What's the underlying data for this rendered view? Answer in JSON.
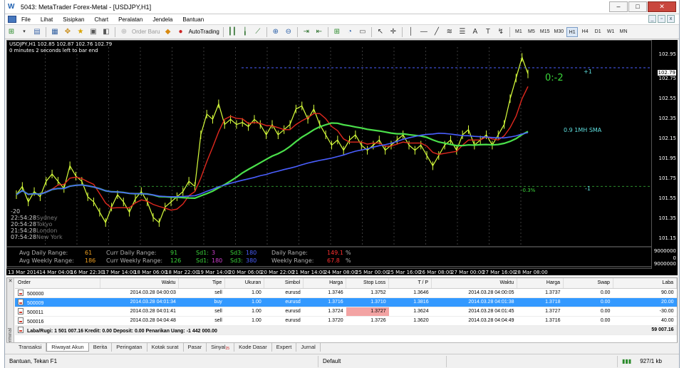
{
  "window": {
    "title": "5043: MetaTrader Forex-Metal - [USDJPY,H1]",
    "buttons": [
      "–",
      "□",
      "✕"
    ]
  },
  "menu": [
    "File",
    "Lihat",
    "Sisipkan",
    "Chart",
    "Peralatan",
    "Jendela",
    "Bantuan"
  ],
  "toolbar": {
    "order_label": "Order Baru",
    "autotrading_label": "AutoTrading",
    "timeframes": [
      "M1",
      "M5",
      "M15",
      "M30",
      "H1",
      "H4",
      "D1",
      "W1",
      "MN"
    ],
    "active_timeframe": "H1"
  },
  "chart": {
    "symbol_line": "USDJPY,H1  102.85 102.87 102.76 102.79",
    "countdown": "0 minutes 2 seconds left to bar end",
    "y_ticks": [
      "102.95",
      "102.75",
      "102.55",
      "102.35",
      "102.15",
      "101.95",
      "101.75",
      "101.55",
      "101.35",
      "101.15"
    ],
    "current_price": "102.79",
    "sub_ticks": [
      "9000000",
      "0",
      "9000000"
    ],
    "x_ticks": [
      "13 Mar 2014",
      "14 Mar 04:00",
      "16 Mar 22:30",
      "17 Mar 14:00",
      "18 Mar 06:00",
      "18 Mar 22:00",
      "19 Mar 14:00",
      "20 Mar 06:00",
      "20 Mar 22:00",
      "21 Mar 14:00",
      "24 Mar 08:00",
      "25 Mar 00:00",
      "25 Mar 16:00",
      "26 Mar 08:00",
      "27 Mar 00:00",
      "27 Mar 16:00",
      "28 Mar 08:00"
    ],
    "annotations": {
      "ratio": "0:-2",
      "sma": "0.9 1MH SMA",
      "plus_one": "+1",
      "minus_one": "-1",
      "pct": "-0.3%"
    },
    "left_levels": [
      "-20",
      "22:54:28",
      "20:54:28",
      "21:54:28",
      "07:54:28"
    ],
    "left_cities": [
      "Sydney",
      "Tokyo",
      "London",
      "New York"
    ],
    "info": {
      "avg_daily_label": "Avg Daily Range:",
      "avg_daily_value": "61",
      "avg_weekly_label": "Avg Weekly Range:",
      "avg_weekly_value": "186",
      "curr_daily_label": "Curr Daily Range:",
      "curr_daily_value": "91",
      "curr_weekly_label": "Curr Weekly Range:",
      "curr_weekly_value": "126",
      "sd1_a": "Sd1:",
      "sd1_a_val": "3",
      "sd3_a": "Sd3:",
      "sd3_a_val": "180",
      "sd1_b": "Sd1:",
      "sd1_b_val": "180",
      "sd3_b": "Sd3:",
      "sd3_b_val": "380",
      "daily_range_label": "Daily Range:",
      "daily_range_val": "149.1",
      "daily_range_unit": "%",
      "weekly_range_label": "Weekly Range:",
      "weekly_range_val": "67.8",
      "weekly_range_unit": "%"
    },
    "colors": {
      "ma_green": "#4be04b",
      "ma_blue": "#4a5fff",
      "ma_red": "#e0281e",
      "price": "#d8ff3c",
      "grid": "#3a3a3a"
    },
    "chart_data": {
      "type": "line",
      "title": "USDJPY,H1",
      "ylim": [
        101.15,
        103.05
      ],
      "series": [
        {
          "values": [
            101.62,
            101.7,
            101.55,
            101.65,
            101.6,
            101.75,
            101.82,
            101.75,
            101.68,
            101.9,
            101.8,
            101.75,
            101.6,
            101.55,
            101.45,
            101.35,
            101.5,
            101.62,
            101.55,
            101.45,
            101.58,
            101.65,
            101.55,
            101.4,
            101.35,
            101.5,
            101.55,
            101.6,
            101.65,
            101.75,
            101.7,
            102.2,
            102.4,
            102.35,
            102.5,
            102.3,
            102.35,
            102.3,
            102.32,
            102.28,
            102.35,
            102.3,
            102.2,
            102.3,
            102.2,
            102.25,
            102.3,
            102.45,
            102.48,
            102.35,
            102.45,
            102.3,
            102.2,
            102.1,
            102.15,
            102.05,
            102.15,
            102.2,
            102.1,
            102.05,
            102.1,
            102.15,
            102.05,
            102.1,
            102.15,
            102.2,
            102.1,
            102.05,
            102.1,
            102.0,
            101.9,
            102.0,
            102.1,
            102.15,
            102.05,
            102.2,
            102.25,
            102.1,
            102.15,
            102.2,
            102.1,
            102.2,
            102.3,
            102.55,
            102.75,
            102.95,
            102.79
          ]
        }
      ]
    }
  },
  "terminal": {
    "label": "Terminal",
    "columns": [
      "Order",
      "Waktu",
      "Tipe",
      "Ukuran",
      "Simbol",
      "Harga",
      "Stop Loss",
      "T / P",
      "Waktu",
      "Harga",
      "Swap",
      "Laba"
    ],
    "rows": [
      [
        "500000",
        "2014.03.28 04:00:03",
        "sell",
        "1.00",
        "eurusd",
        "1.3746",
        "1.3752",
        "1.3646",
        "2014.03.28 04:00:05",
        "1.3737",
        "0.00",
        "90.00"
      ],
      [
        "500009",
        "2014.03.28 04:01:34",
        "buy",
        "1.00",
        "eurusd",
        "1.3716",
        "1.3710",
        "1.3816",
        "2014.03.28 04:01:38",
        "1.3718",
        "0.00",
        "20.00"
      ],
      [
        "500011",
        "2014.03.28 04:01:41",
        "sell",
        "1.00",
        "eurusd",
        "1.3724",
        "1.3727",
        "1.3624",
        "2014.03.28 04:01:45",
        "1.3727",
        "0.00",
        "-30.00"
      ],
      [
        "500016",
        "2014.03.28 04:04:48",
        "sell",
        "1.00",
        "eurusd",
        "1.3720",
        "1.3726",
        "1.3620",
        "2014.03.28 04:04:49",
        "1.3716",
        "0.00",
        "40.00"
      ]
    ],
    "summary_left": "Laba/Rugi: 1 501 007.16  Kredit: 0.00  Deposit: 0.00  Penarikan Uang: -1 442 000.00",
    "summary_right": "59 007.16",
    "tabs": [
      "Transaksi",
      "Riwayat Akun",
      "Berita",
      "Peringatan",
      "Kotak surat",
      "Pasar",
      "Sinyal",
      "Kode Dasar",
      "Expert",
      "Jurnal"
    ],
    "signal_badge": "25",
    "active_tab": "Riwayat Akun"
  },
  "statusbar": {
    "help": "Bantuan, Tekan F1",
    "profile": "Default",
    "traffic": "927/1 kb"
  }
}
